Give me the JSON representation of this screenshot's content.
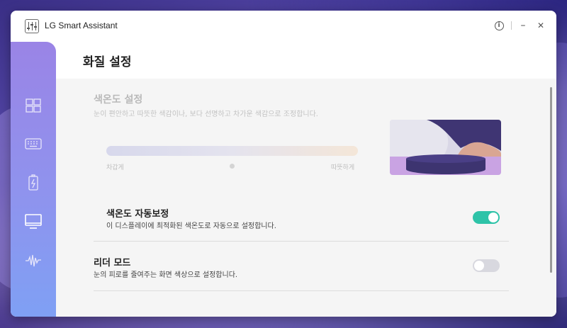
{
  "app": {
    "title": "LG Smart Assistant"
  },
  "titlebar": {
    "minimize_glyph": "–",
    "close_glyph": "✕",
    "info_glyph": "i"
  },
  "page": {
    "title": "화질 설정"
  },
  "color_temperature": {
    "title": "색온도 설정",
    "description": "눈이 편안하고 따뜻한 색감이나, 보다 선명하고 차가운 색감으로 조정합니다.",
    "left_label": "차갑게",
    "right_label": "따뜻하게",
    "level": 0.5
  },
  "auto_color_temp": {
    "title": "색온도 자동보정",
    "description": "이 디스플레이에 최적화된 색온도로 자동으로 설정합니다.",
    "enabled": true
  },
  "reader_mode": {
    "title": "리더 모드",
    "description": "눈의 피로를 줄여주는 화면 색상으로 설정합니다.",
    "enabled": false
  },
  "colors": {
    "toggle_on": "#2ec3a8",
    "toggle_off": "#d8d8df",
    "sidebar_top": "#9a84e6",
    "sidebar_bottom": "#7fa0f4"
  },
  "sidebar": {
    "items": [
      {
        "icon": "dashboard-icon",
        "active": false
      },
      {
        "icon": "keyboard-icon",
        "active": false
      },
      {
        "icon": "battery-icon",
        "active": false
      },
      {
        "icon": "monitor-icon",
        "active": true
      },
      {
        "icon": "sound-wave-icon",
        "active": false
      }
    ]
  }
}
